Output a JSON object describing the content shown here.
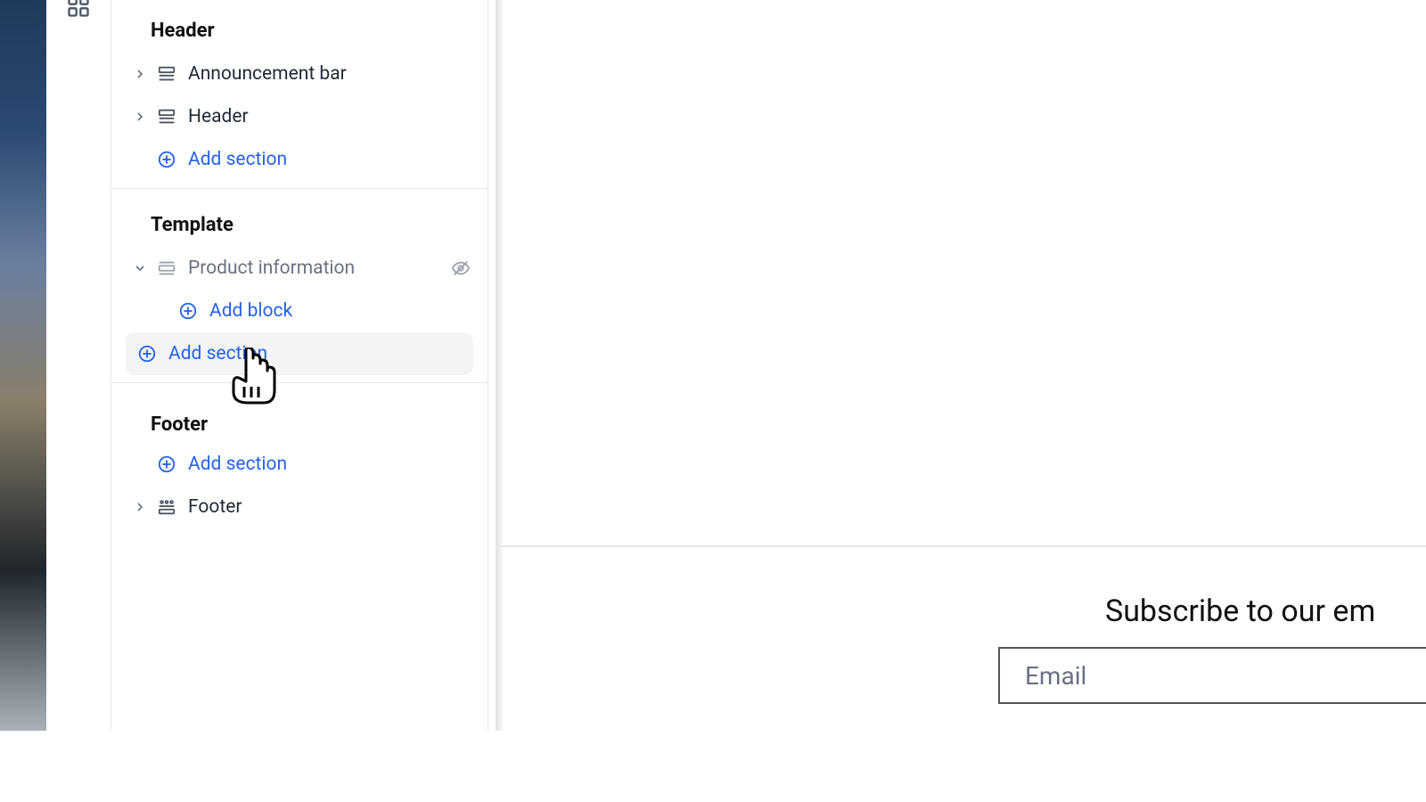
{
  "rail": {
    "icon": "sections-icon"
  },
  "sidebar": {
    "groups": {
      "header": {
        "title": "Header",
        "items": [
          {
            "label": "Announcement bar"
          },
          {
            "label": "Header"
          }
        ],
        "add_section": "Add section"
      },
      "template": {
        "title": "Template",
        "items": [
          {
            "label": "Product information"
          }
        ],
        "add_block": "Add block",
        "add_section": "Add section"
      },
      "footer": {
        "title": "Footer",
        "add_section": "Add section",
        "items": [
          {
            "label": "Footer"
          }
        ]
      }
    }
  },
  "preview": {
    "subscribe_heading": "Subscribe to our em",
    "email_placeholder": "Email"
  },
  "colors": {
    "accent": "#2563eb"
  }
}
